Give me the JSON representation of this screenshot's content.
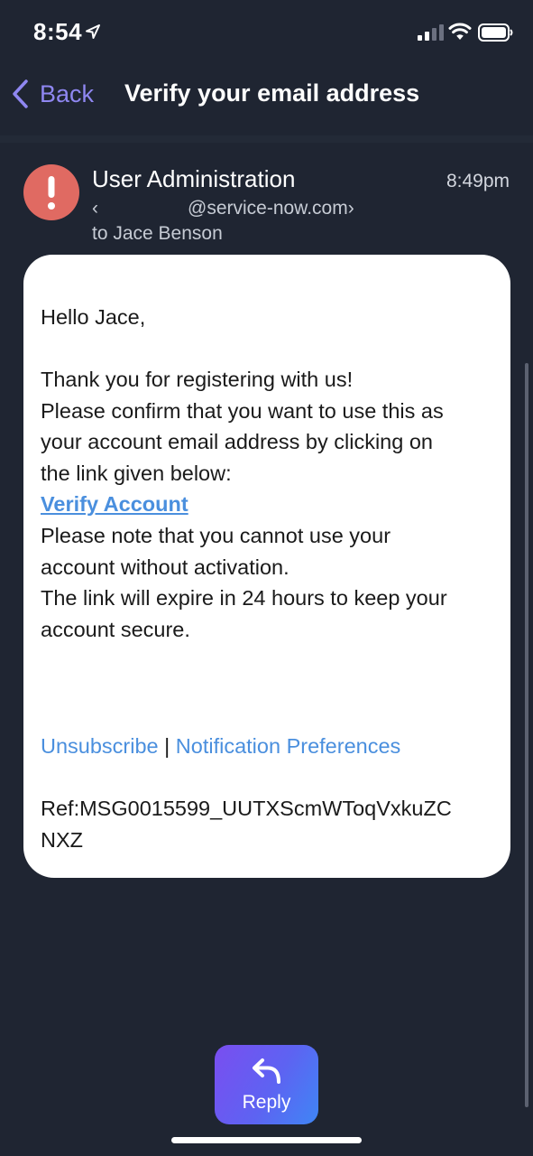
{
  "status_bar": {
    "time": "8:54",
    "icons": [
      "location-arrow-icon",
      "cellular-signal-icon",
      "wifi-icon",
      "battery-icon"
    ]
  },
  "nav": {
    "back_label": "Back",
    "title": "Verify your email address"
  },
  "message": {
    "sender_name": "User Administration",
    "sender_email_open": "‹",
    "sender_email": "@service-now.com›",
    "recipient": "to Jace Benson",
    "time": "8:49pm",
    "avatar_icon": "exclamation-icon"
  },
  "body": {
    "greeting": "Hello Jace,",
    "lines": [
      "Thank you for registering with us!",
      "Please confirm that you want to use this as",
      "your account email address by clicking on",
      "the link given below:"
    ],
    "verify_link": "Verify Account",
    "lines_after": [
      "Please note that you cannot use your",
      "account without activation.",
      "The link will expire in 24 hours to keep your",
      "account secure."
    ],
    "footer": {
      "unsubscribe": "Unsubscribe",
      "separator": "|",
      "preferences": "Notification Preferences"
    },
    "ref_lines": [
      "Ref:MSG0015599_UUTXScmWToqVxkuZC",
      "NXZ"
    ]
  },
  "reply_button": {
    "label": "Reply",
    "icon": "reply-arrow-icon"
  },
  "colors": {
    "background": "#1f2532",
    "accent_back": "#8f87f1",
    "link": "#4a8fde",
    "avatar": "#e06a62",
    "reply_gradient_start": "#7a4ef0",
    "reply_gradient_end": "#3f86f5"
  }
}
